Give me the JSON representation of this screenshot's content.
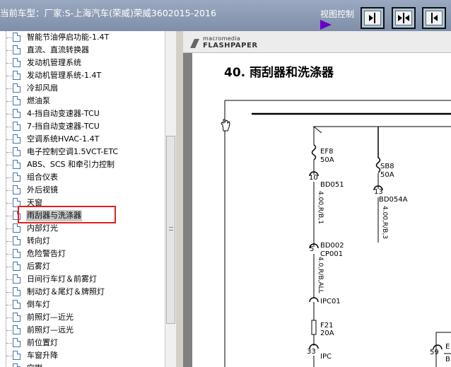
{
  "header": {
    "vehicle_title": "当前车型：厂家:S-上海汽车(荣威)荣威3602015-2016",
    "view_control_label": "视图控制"
  },
  "view_buttons": [
    {
      "name": "collapse-left-button"
    },
    {
      "name": "split-view-button"
    },
    {
      "name": "collapse-right-button"
    }
  ],
  "tree": {
    "items": [
      {
        "label": "智能节油停启功能-1.4T"
      },
      {
        "label": "直流、直流转换器"
      },
      {
        "label": "发动机管理系统"
      },
      {
        "label": "发动机管理系统-1.4T"
      },
      {
        "label": "冷却风扇"
      },
      {
        "label": "燃油泵"
      },
      {
        "label": "4-挡自动变速器-TCU"
      },
      {
        "label": "7-挡自动变速器-TCU"
      },
      {
        "label": "空调系统HVAC-1.4T"
      },
      {
        "label": "电子控制空调1.5VCT-ETC"
      },
      {
        "label": "ABS、SCS 和牵引力控制"
      },
      {
        "label": "组合仪表"
      },
      {
        "label": "外后视镜"
      },
      {
        "label": "天窗"
      },
      {
        "label": "雨刮器与洗涤器",
        "selected": true
      },
      {
        "label": "内部灯光"
      },
      {
        "label": "转向灯"
      },
      {
        "label": "危险警告灯"
      },
      {
        "label": "后雾灯"
      },
      {
        "label": "日间行车灯＆前雾灯"
      },
      {
        "label": "制动灯＆尾灯＆牌照灯"
      },
      {
        "label": "倒车灯"
      },
      {
        "label": "前照灯—近光"
      },
      {
        "label": "前照灯—远光"
      },
      {
        "label": "前位置灯"
      },
      {
        "label": "车窗升降"
      },
      {
        "label": "空喇"
      }
    ]
  },
  "viewer": {
    "brand_small": "macromedia",
    "brand_large": "FLASHPAPER",
    "page_title": "40.  雨刮器和洗涤器",
    "diagram": {
      "ef8_name": "EF8",
      "ef8_rating": "50A",
      "sb8_name": "SB8",
      "sb8_rating": "50A",
      "pin10": "10",
      "bd051": "BD051",
      "pin13": "13",
      "bd054a": "BD054A",
      "wire1": "4.00,R/B,1",
      "wire2": "4.00,R/B,3",
      "pin5": "5",
      "bd002": "BD002",
      "cp001": "CP001",
      "wire3": "4.0,R/B,ALL",
      "ipc01": "IPC01",
      "f21_name": "F21",
      "f21_rating": "20A",
      "pin33": "33",
      "ipc": "IPC",
      "pin59": "59",
      "right_e": "E",
      "right_b": "B"
    }
  }
}
